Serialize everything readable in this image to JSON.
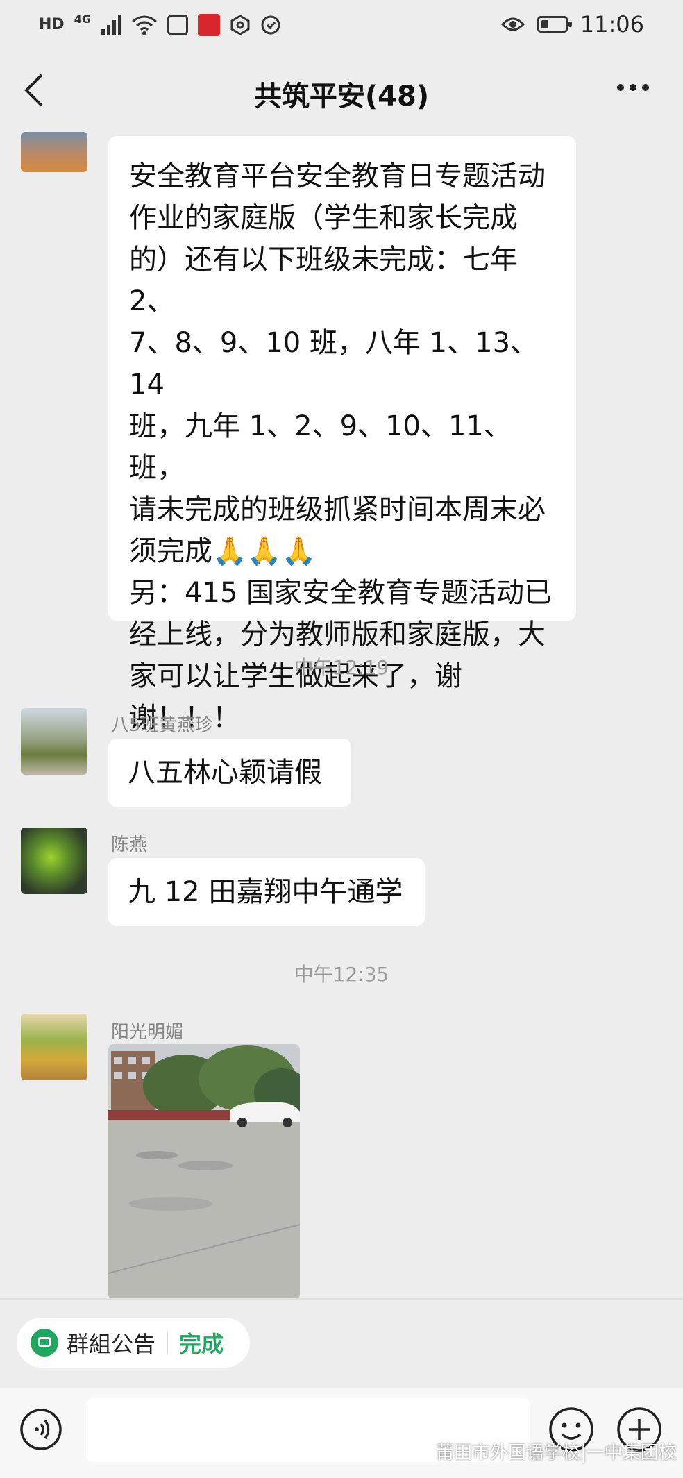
{
  "status_bar": {
    "network_badge": "HD",
    "signal_label": "4G",
    "time": "11:06",
    "icons": [
      "hd-icon",
      "4g-signal-icon",
      "wifi-icon",
      "message-icon",
      "news-app-icon",
      "settings-icon",
      "shield-icon",
      "eye-icon",
      "battery-icon"
    ],
    "battery_level": 0.3
  },
  "header": {
    "title": "共筑平安(48)",
    "back_icon": "chevron-left-icon",
    "more_icon": "more-dots-icon"
  },
  "messages": [
    {
      "sender": "",
      "lines": [
        "安全教育平台安全教育日专题活动",
        "作业的家庭版（学生和家长完成",
        "的）还有以下班级未完成：七年 2、",
        "7、8、9、10 班，八年 1、13、14",
        "班，九年 1、2、9、10、11、班，",
        "请未完成的班级抓紧时间本周末必",
        "须完成🙏🙏🙏",
        "另：415 国家安全教育专题活动已",
        "经上线，分为教师版和家庭版，大",
        "家可以让学生做起来了，谢",
        "谢！！！"
      ]
    },
    {
      "time": "中午12:19"
    },
    {
      "sender": "八5班黄燕珍",
      "text": "八五林心颖请假"
    },
    {
      "sender": "陈燕",
      "text": "九 12 田嘉翔中午通学"
    },
    {
      "time": "中午12:35"
    },
    {
      "sender": "阳光明媚",
      "image": "photo-school-courtyard"
    }
  ],
  "notice_bar": {
    "label": "群組公告",
    "status": "完成",
    "accent": "#1fa660"
  },
  "input_bar": {
    "icons": [
      "voice-icon",
      "emoji-icon",
      "plus-icon"
    ]
  },
  "watermark": "莆田市外国语学校|一中集团校",
  "colors": {
    "background": "#ededed",
    "bubble": "#ffffff",
    "accent_green": "#1fa660"
  }
}
